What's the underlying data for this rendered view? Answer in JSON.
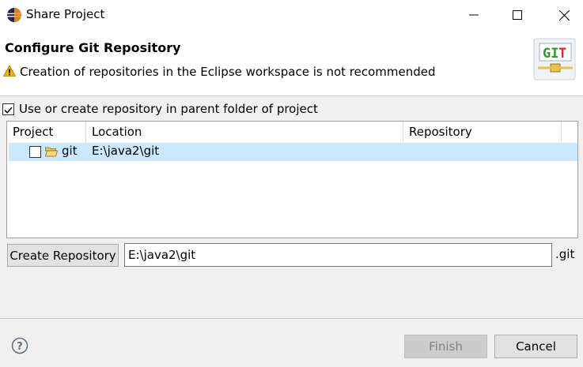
{
  "window": {
    "title": "Share Project",
    "app_icon": "eclipse-icon"
  },
  "header": {
    "title": "Configure Git Repository",
    "warning_icon": "warning-icon",
    "warning_message": "Creation of repositories in the Eclipse workspace is not recommended",
    "banner_icon_text": "GIT"
  },
  "options": {
    "parent_repo_label": "Use or create repository in parent folder of project",
    "parent_repo_checked": true
  },
  "table": {
    "columns": [
      "Project",
      "Location",
      "Repository"
    ],
    "rows": [
      {
        "checked": false,
        "icon": "folder-icon",
        "project": "git",
        "location": "E:\\java2\\git",
        "repository": ""
      }
    ]
  },
  "create_repo": {
    "button_label": "Create Repository",
    "path_value": "E:\\java2\\git",
    "suffix": ".git"
  },
  "footer": {
    "help_icon": "help-icon",
    "finish_label": "Finish",
    "finish_enabled": false,
    "cancel_label": "Cancel"
  },
  "colors": {
    "selection": "#cce8ff",
    "warning": "#f0b400",
    "git_green": "#2e9a2e",
    "git_red": "#d22b2b"
  }
}
